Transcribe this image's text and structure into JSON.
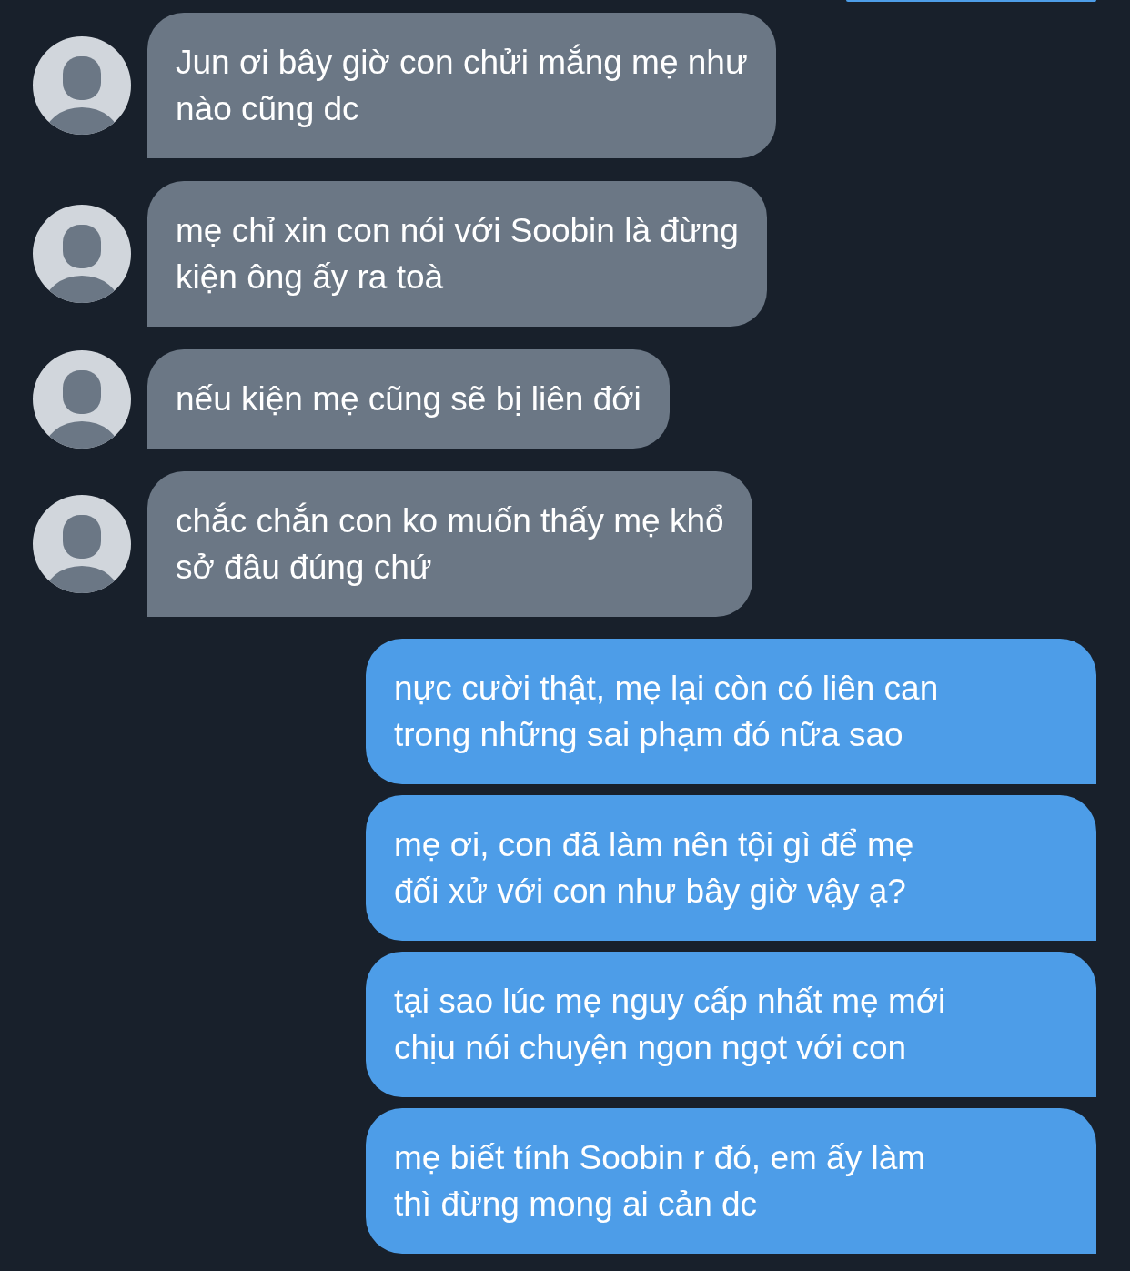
{
  "messages": [
    {
      "kind": "sent_partial"
    },
    {
      "kind": "received",
      "text": "Jun ơi bây giờ con chửi mắng mẹ như\nnào cũng dc"
    },
    {
      "kind": "received",
      "text": "mẹ chỉ xin con nói với Soobin là đừng\nkiện ông ấy ra toà"
    },
    {
      "kind": "received",
      "text": "nếu kiện mẹ cũng sẽ bị liên đới"
    },
    {
      "kind": "received",
      "text": "chắc chắn con ko muốn thấy mẹ khổ\nsở đâu đúng chứ"
    },
    {
      "kind": "sent",
      "text": "nực cười thật, mẹ lại còn có liên can\ntrong những sai phạm đó nữa sao"
    },
    {
      "kind": "sent",
      "text": "mẹ ơi, con đã làm nên tội gì để mẹ\nđối xử với con như bây giờ vậy ạ?"
    },
    {
      "kind": "sent",
      "text": "tại sao lúc mẹ nguy cấp nhất mẹ mới\nchịu nói chuyện ngon ngọt với con"
    },
    {
      "kind": "sent",
      "text": "mẹ biết tính Soobin r đó, em ấy làm\nthì đừng mong ai cản dc"
    }
  ]
}
